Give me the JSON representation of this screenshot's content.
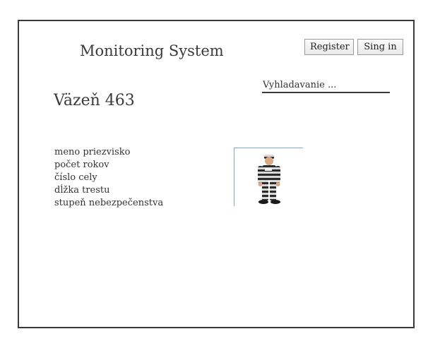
{
  "header": {
    "app_title": "Monitoring System",
    "register_label": "Register",
    "signin_label": "Sing in"
  },
  "search": {
    "placeholder": "Vyhladavanie ..."
  },
  "prisoner": {
    "title": "Väzeň 463",
    "fields": [
      "meno priezvisko",
      "počet rokov",
      "číslo cely",
      "dĺžka trestu",
      "stupeň nebezpečenstva"
    ],
    "photo_icon": "prisoner-photo"
  }
}
